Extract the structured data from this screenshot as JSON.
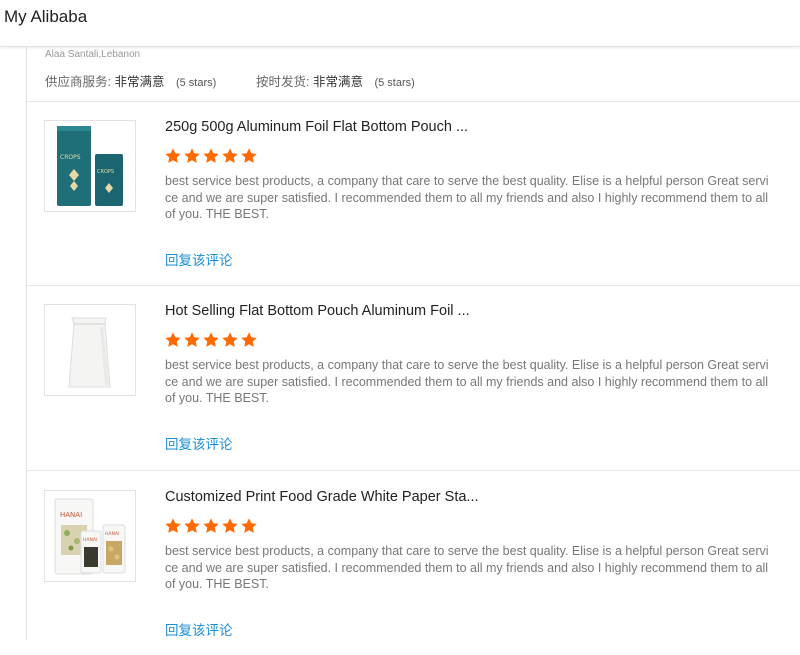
{
  "app": {
    "title": "My Alibaba"
  },
  "reviewer": {
    "name_location": "Alaa Santali,Lebanon",
    "supplier_service_label": "供应商服务:",
    "supplier_service_value": "非常满意",
    "supplier_service_stars": "(5 stars)",
    "on_time_label": "按时发货:",
    "on_time_value": "非常满意",
    "on_time_stars": "(5 stars)"
  },
  "colors": {
    "star": "#ff6a00",
    "link": "#1a8fd6"
  },
  "reviews": [
    {
      "title": "250g 500g Aluminum Foil Flat Bottom Pouch ...",
      "rating": 5,
      "text": "best service best products, a company that care to serve the best quality. Elise is a helpful person Great service and we are super satisfied. I recommended them to all my friends and also I highly recommend them to all of you. THE BEST.",
      "reply": "回复该评论",
      "thumb_icon": "teal-pouch-image"
    },
    {
      "title": "Hot Selling Flat Bottom Pouch Aluminum Foil ...",
      "rating": 5,
      "text": "best service best products, a company that care to serve the best quality. Elise is a helpful person Great service and we are super satisfied. I recommended them to all my friends and also I highly recommend them to all of you. THE BEST.",
      "reply": "回复该评论",
      "thumb_icon": "white-pouch-image"
    },
    {
      "title": "Customized Print Food Grade White Paper Sta...",
      "rating": 5,
      "text": "best service best products, a company that care to serve the best quality. Elise is a helpful person Great service and we are super satisfied. I recommended them to all my friends and also I highly recommend them to all of you. THE BEST.",
      "reply": "回复该评论",
      "thumb_icon": "hanai-pouch-image"
    }
  ]
}
